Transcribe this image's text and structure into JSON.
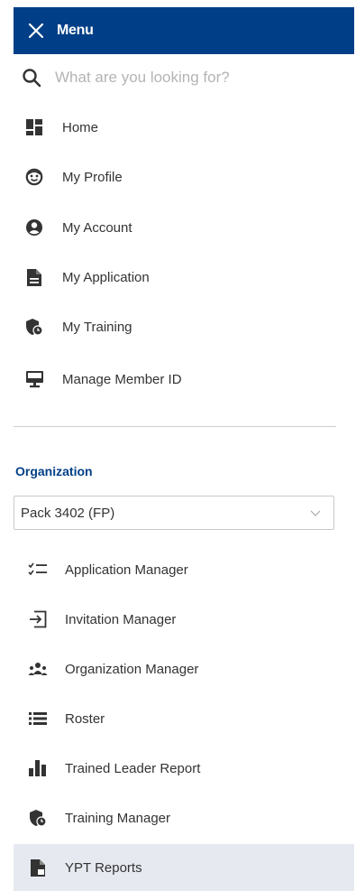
{
  "header": {
    "title": "Menu",
    "close_icon": "close-icon",
    "background": "#003f87"
  },
  "search": {
    "placeholder": "What are you looking for?",
    "value": "",
    "icon": "search-icon"
  },
  "nav": {
    "items": [
      {
        "label": "Home",
        "icon": "dashboard-icon"
      },
      {
        "label": "My Profile",
        "icon": "face-icon"
      },
      {
        "label": "My Account",
        "icon": "account-circle-icon"
      },
      {
        "label": "My Application",
        "icon": "document-icon"
      },
      {
        "label": "My Training",
        "icon": "shield-clock-icon"
      },
      {
        "label": "Manage Member ID",
        "icon": "monitor-icon"
      }
    ]
  },
  "organization": {
    "heading": "Organization",
    "selected": "Pack 3402 (FP)",
    "items": [
      {
        "label": "Application Manager",
        "icon": "checklist-icon"
      },
      {
        "label": "Invitation Manager",
        "icon": "login-box-icon"
      },
      {
        "label": "Organization Manager",
        "icon": "people-group-icon"
      },
      {
        "label": "Roster",
        "icon": "list-icon"
      },
      {
        "label": "Trained Leader Report",
        "icon": "bar-chart-icon"
      },
      {
        "label": "Training Manager",
        "icon": "shield-clock-icon"
      },
      {
        "label": "YPT Reports",
        "icon": "report-file-icon",
        "active": true
      }
    ]
  },
  "colors": {
    "accent": "#003f87",
    "active_bg": "#e6e9f0",
    "icon": "#333333"
  }
}
